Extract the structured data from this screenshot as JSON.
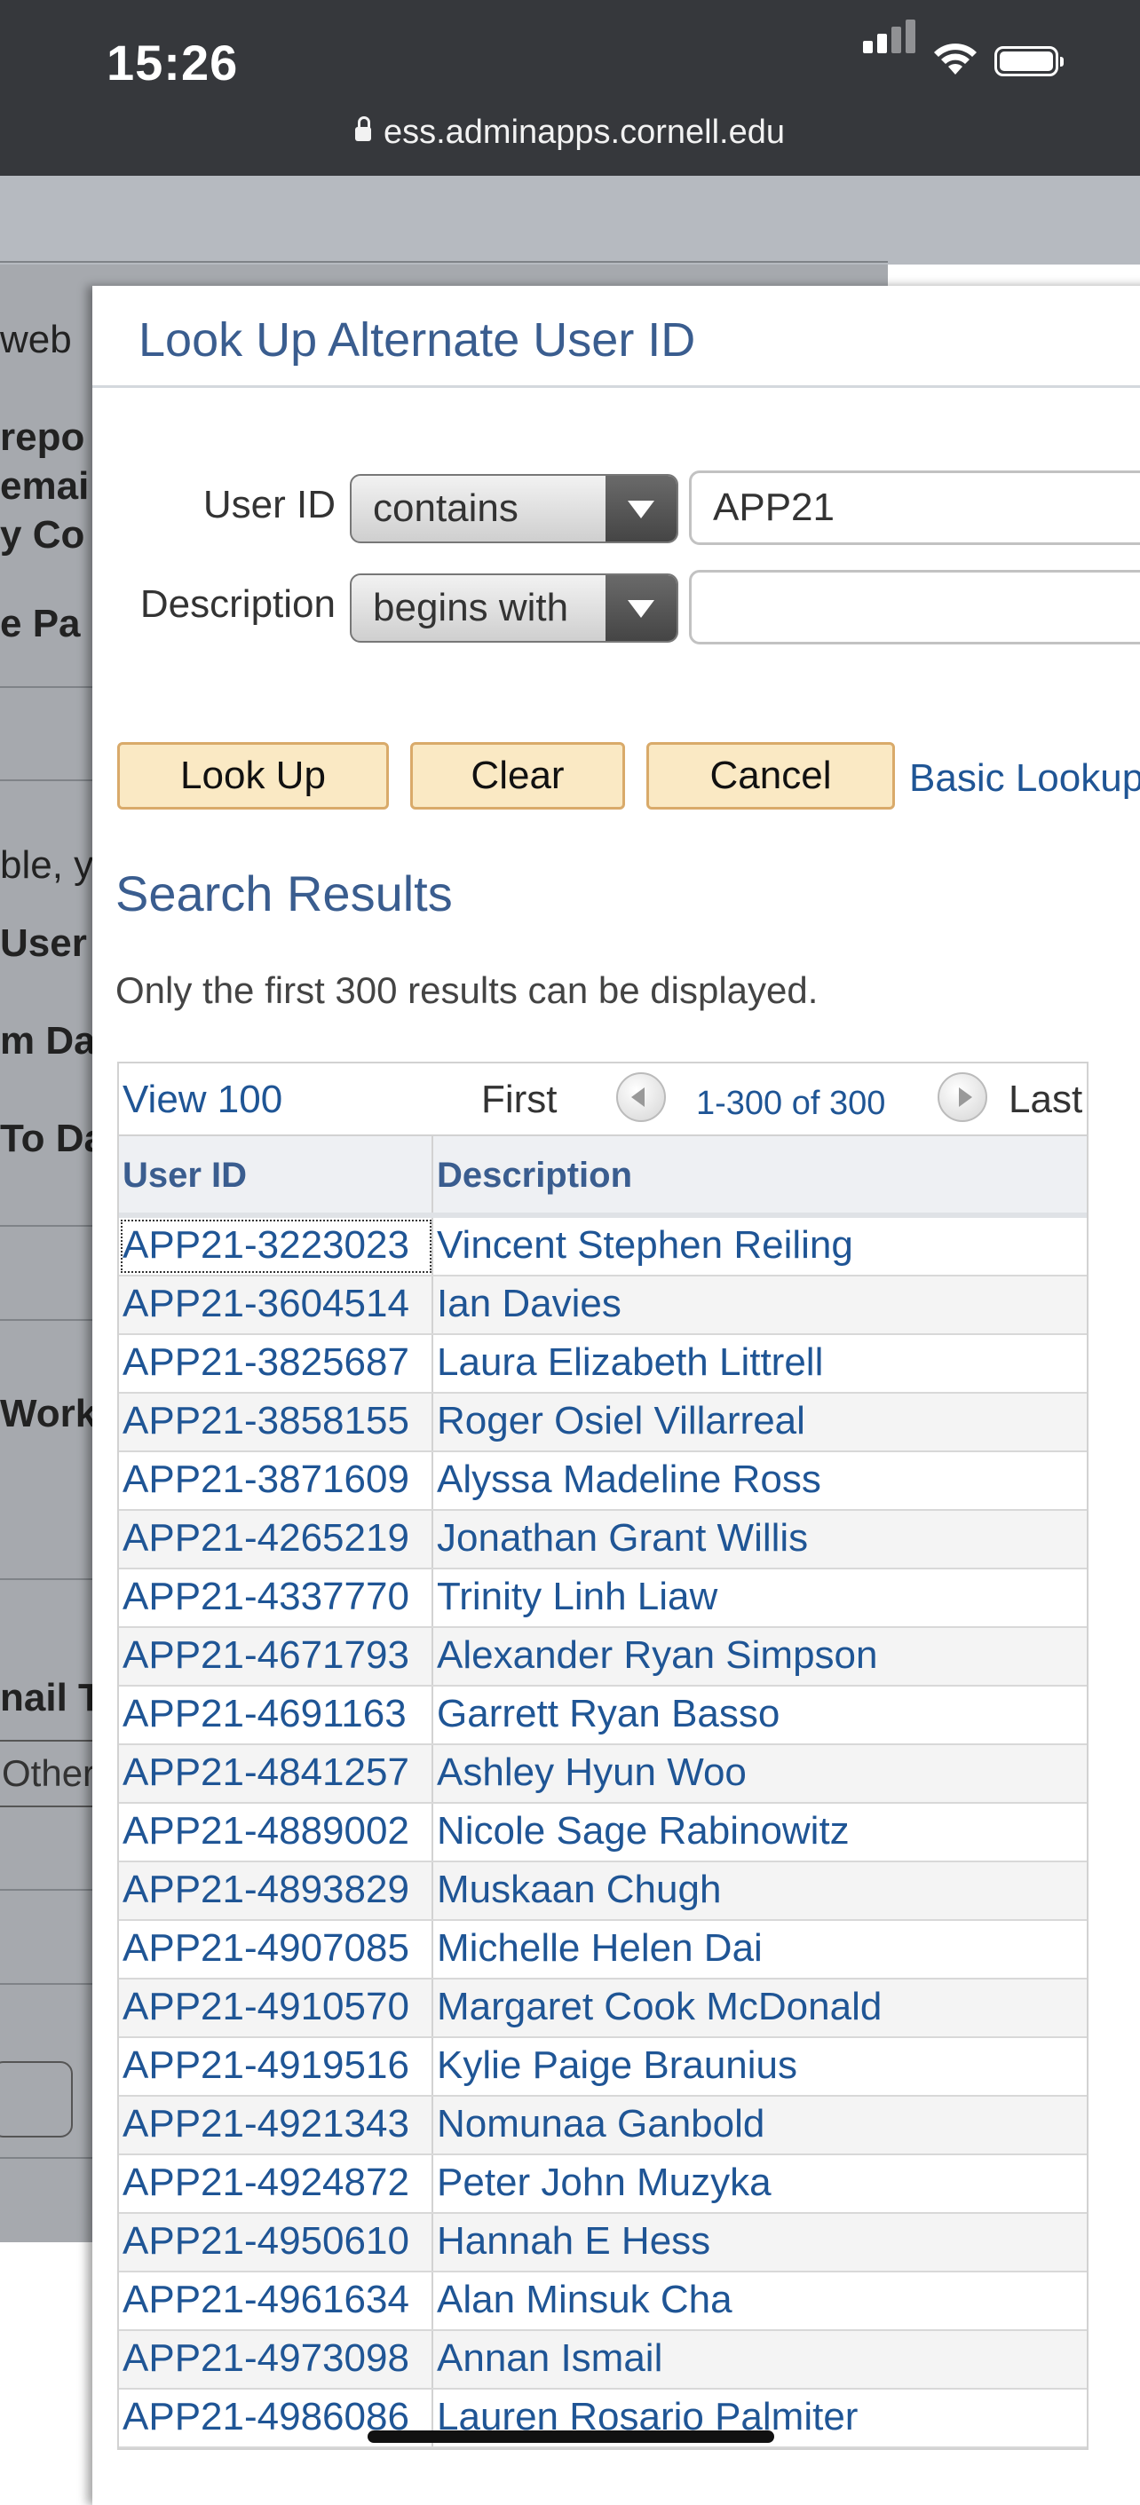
{
  "status_bar": {
    "time": "15:26",
    "url": "ess.adminapps.cornell.edu"
  },
  "background_page": {
    "fragments": [
      "web",
      "repo",
      "emai",
      "y Co",
      "e Pa",
      "ble, y",
      "User",
      "m Da",
      "To Da",
      "Work",
      "nail T",
      "Other"
    ]
  },
  "modal": {
    "title": "Look Up Alternate User ID",
    "criteria": [
      {
        "label": "User ID",
        "operator": "contains",
        "value": "APP21"
      },
      {
        "label": "Description",
        "operator": "begins with",
        "value": ""
      }
    ],
    "buttons": {
      "lookup": "Look Up",
      "clear": "Clear",
      "cancel": "Cancel",
      "basic_lookup": "Basic Lookup"
    },
    "results_title": "Search Results",
    "results_note": "Only the first 300 results can be displayed.",
    "grid": {
      "view_link": "View 100",
      "first": "First",
      "range": "1-300 of 300",
      "last": "Last",
      "columns": [
        "User ID",
        "Description"
      ],
      "rows": [
        [
          "APP21-3223023",
          "Vincent Stephen Reiling"
        ],
        [
          "APP21-3604514",
          "Ian Davies"
        ],
        [
          "APP21-3825687",
          "Laura Elizabeth Littrell"
        ],
        [
          "APP21-3858155",
          "Roger Osiel Villarreal"
        ],
        [
          "APP21-3871609",
          "Alyssa Madeline Ross"
        ],
        [
          "APP21-4265219",
          "Jonathan Grant Willis"
        ],
        [
          "APP21-4337770",
          "Trinity Linh Liaw"
        ],
        [
          "APP21-4671793",
          "Alexander Ryan Simpson"
        ],
        [
          "APP21-4691163",
          "Garrett Ryan Basso"
        ],
        [
          "APP21-4841257",
          "Ashley Hyun Woo"
        ],
        [
          "APP21-4889002",
          "Nicole Sage Rabinowitz"
        ],
        [
          "APP21-4893829",
          "Muskaan Chugh"
        ],
        [
          "APP21-4907085",
          "Michelle Helen Dai"
        ],
        [
          "APP21-4910570",
          "Margaret Cook McDonald"
        ],
        [
          "APP21-4919516",
          "Kylie Paige Braunius"
        ],
        [
          "APP21-4921343",
          "Nomunaa Ganbold"
        ],
        [
          "APP21-4924872",
          "Peter John Muzyka"
        ],
        [
          "APP21-4950610",
          "Hannah E Hess"
        ],
        [
          "APP21-4961634",
          "Alan Minsuk Cha"
        ],
        [
          "APP21-4973098",
          "Annan Ismail"
        ],
        [
          "APP21-4986086",
          "Lauren Rosario Palmiter"
        ]
      ]
    }
  }
}
